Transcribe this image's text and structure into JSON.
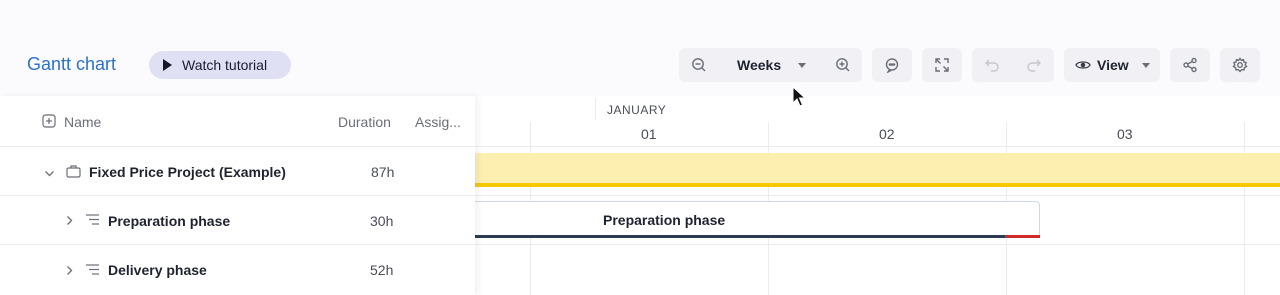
{
  "header": {
    "title": "Gantt chart",
    "tutorial_label": "Watch tutorial"
  },
  "toolbar": {
    "zoom_level": "Weeks",
    "view_label": "View",
    "icons": [
      "zoom-out-icon",
      "zoom-in-icon",
      "comment-icon",
      "fullscreen-icon",
      "undo-icon",
      "redo-icon",
      "eye-icon",
      "share-icon",
      "settings-icon"
    ]
  },
  "grid": {
    "columns": {
      "name": "Name",
      "duration": "Duration",
      "assignee": "Assig..."
    },
    "rows": [
      {
        "name": "Fixed Price Project (Example)",
        "duration": "87h",
        "type": "project",
        "expanded": true
      },
      {
        "name": "Preparation phase",
        "duration": "30h",
        "type": "phase",
        "expanded": false
      },
      {
        "name": "Delivery phase",
        "duration": "52h",
        "type": "phase",
        "expanded": false
      }
    ]
  },
  "timeline": {
    "month": "JANUARY",
    "days": [
      "01",
      "02",
      "03"
    ],
    "bars": [
      {
        "label": "Preparation phase"
      }
    ]
  },
  "colors": {
    "title": "#2b72c8",
    "project_bar": "#fcefb0",
    "project_bar_border": "#f5c800",
    "phase_underline": "#2d3a55",
    "overdue": "#d22a2a"
  }
}
